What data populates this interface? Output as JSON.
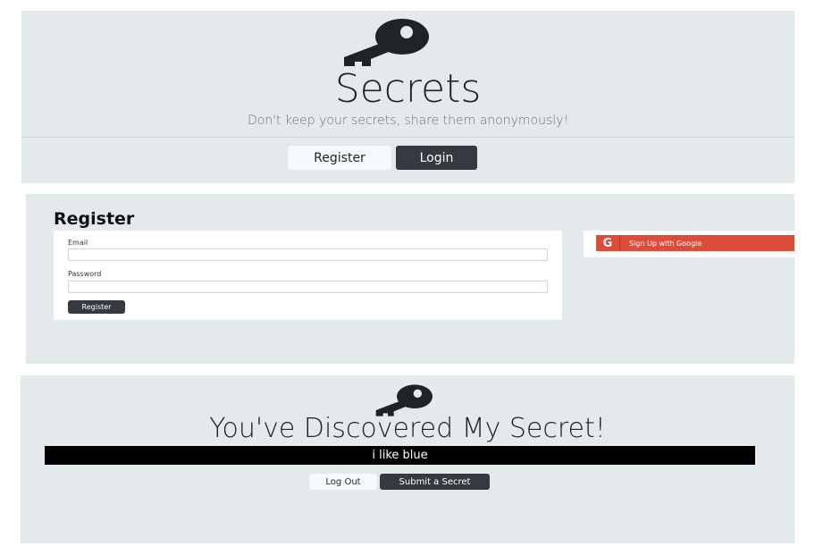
{
  "home": {
    "title": "Secrets",
    "subtitle": "Don't keep your secrets, share them anonymously!",
    "register_button": "Register",
    "login_button": "Login"
  },
  "register": {
    "heading": "Register",
    "email_label": "Email",
    "password_label": "Password",
    "submit_button": "Register",
    "google_button": "Sign Up with Google",
    "google_icon_letter": "G"
  },
  "secrets": {
    "heading": "You've Discovered My Secret!",
    "secret_text": "i like blue",
    "logout_button": "Log Out",
    "submit_secret_button": "Submit a Secret"
  },
  "colors": {
    "panel_bg": "#e4e9ec",
    "dark": "#343a40",
    "google_red": "#dd4b39"
  },
  "icons": [
    "key-icon",
    "google-icon"
  ]
}
